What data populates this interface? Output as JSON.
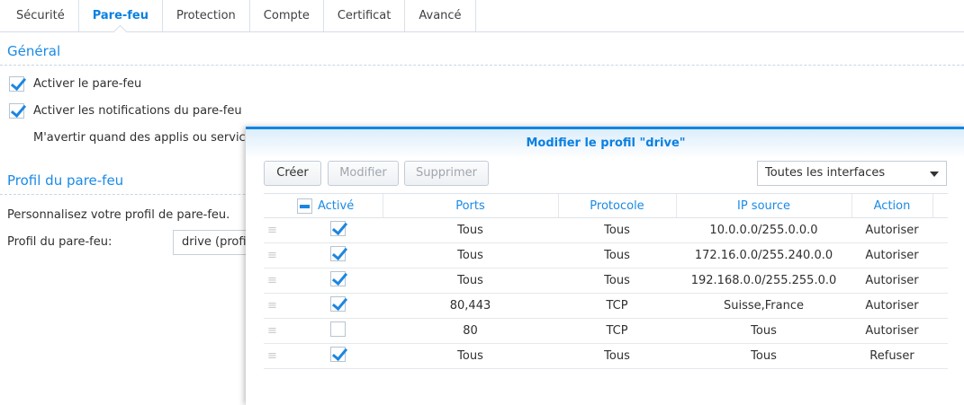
{
  "tabs": [
    {
      "label": "Sécurité"
    },
    {
      "label": "Pare-feu"
    },
    {
      "label": "Protection"
    },
    {
      "label": "Compte"
    },
    {
      "label": "Certificat"
    },
    {
      "label": "Avancé"
    }
  ],
  "general": {
    "title": "Général",
    "enable_firewall": "Activer le pare-feu",
    "enable_notifications": "Activer les notifications du pare-feu",
    "warn_text": "M'avertir quand des applis ou service"
  },
  "profile": {
    "title": "Profil du pare-feu",
    "desc": "Personnalisez votre profil de pare-feu.",
    "label": "Profil du pare-feu:",
    "value": "drive (profil"
  },
  "dialog": {
    "title": "Modifier le profil \"drive\"",
    "create": "Créer",
    "edit": "Modifier",
    "delete": "Supprimer",
    "interfaces": "Toutes les interfaces",
    "columns": [
      "Activé",
      "Ports",
      "Protocole",
      "IP source",
      "Action"
    ],
    "rows": [
      {
        "enabled": true,
        "ports": "Tous",
        "protocol": "Tous",
        "ip": "10.0.0.0/255.0.0.0",
        "action": "Autoriser"
      },
      {
        "enabled": true,
        "ports": "Tous",
        "protocol": "Tous",
        "ip": "172.16.0.0/255.240.0.0",
        "action": "Autoriser"
      },
      {
        "enabled": true,
        "ports": "Tous",
        "protocol": "Tous",
        "ip": "192.168.0.0/255.255.0.0",
        "action": "Autoriser"
      },
      {
        "enabled": true,
        "ports": "80,443",
        "protocol": "TCP",
        "ip": "Suisse,France",
        "action": "Autoriser"
      },
      {
        "enabled": false,
        "ports": "80",
        "protocol": "TCP",
        "ip": "Tous",
        "action": "Autoriser"
      },
      {
        "enabled": true,
        "ports": "Tous",
        "protocol": "Tous",
        "ip": "Tous",
        "action": "Refuser"
      }
    ]
  }
}
